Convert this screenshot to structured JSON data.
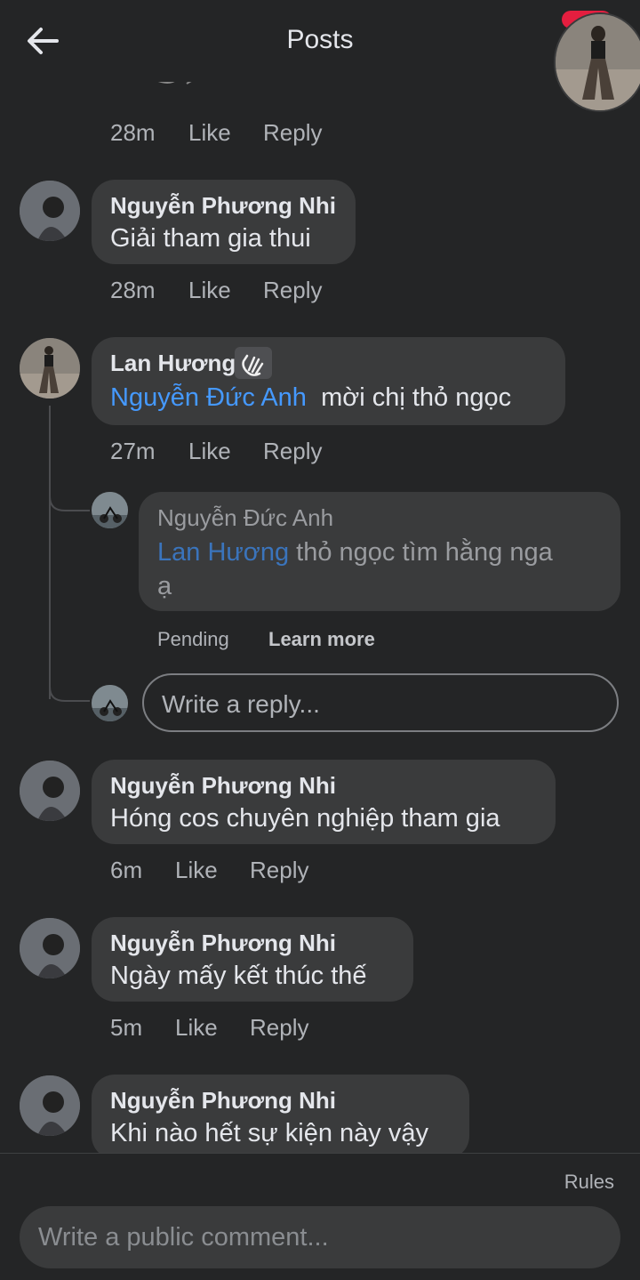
{
  "header": {
    "title": "Posts"
  },
  "top_meta": {
    "time": "28m",
    "like": "Like",
    "reply": "Reply"
  },
  "comments": [
    {
      "name": "Nguyễn Phương Nhi",
      "text": "Giải tham gia thui",
      "time": "28m",
      "like": "Like",
      "reply": "Reply"
    },
    {
      "name": "Lan Hương",
      "mention": "Nguyễn Đức Anh",
      "text": "mời chị thỏ ngọc",
      "time": "27m",
      "like": "Like",
      "reply": "Reply"
    },
    {
      "name": "Nguyễn Phương Nhi",
      "text": "Hóng cos chuyên nghiệp tham gia",
      "time": "6m",
      "like": "Like",
      "reply": "Reply"
    },
    {
      "name": "Nguyễn Phương Nhi",
      "text": "Ngày mấy kết thúc thế",
      "time": "5m",
      "like": "Like",
      "reply": "Reply"
    },
    {
      "name": "Nguyễn Phương Nhi",
      "text": "Khi nào hết sự kiện này vậy"
    }
  ],
  "pending_reply": {
    "name": "Nguyễn Đức Anh",
    "mention": "Lan Hương",
    "text_line1": "thỏ ngọc tìm hằng nga",
    "text_line2": "ạ",
    "status": "Pending",
    "learn_more": "Learn more"
  },
  "reply_box": {
    "placeholder": "Write a reply..."
  },
  "footer": {
    "rules": "Rules",
    "comment_placeholder": "Write a public comment..."
  },
  "icons": {
    "back": "arrow-left-icon",
    "wave": "waving-hand-icon"
  }
}
